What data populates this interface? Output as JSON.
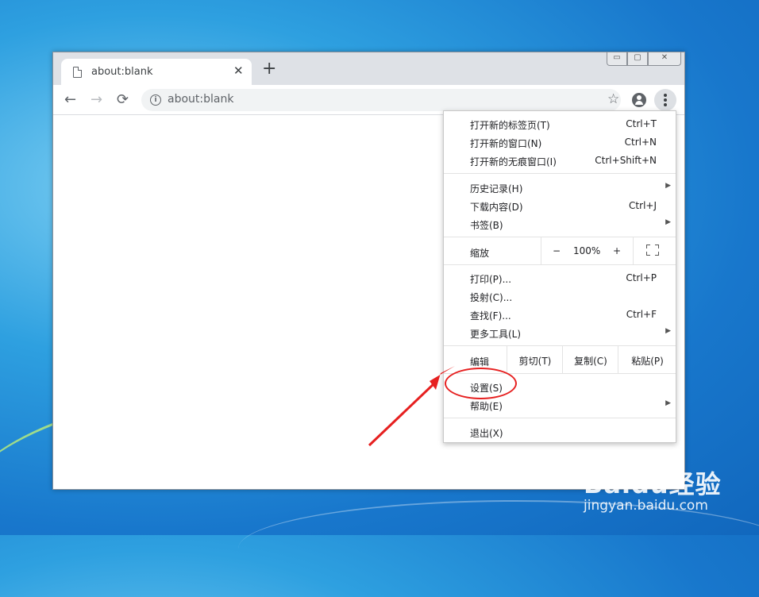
{
  "tab": {
    "title": "about:blank",
    "close_glyph": "✕",
    "new_tab_glyph": "+"
  },
  "window_controls": {
    "minimize": "▭",
    "maximize": "▢",
    "close": "✕"
  },
  "toolbar": {
    "back": "←",
    "forward": "→",
    "reload": "⟳",
    "url": "about:blank",
    "info_glyph": "i",
    "star": "☆"
  },
  "menu": {
    "new_tab": {
      "label": "打开新的标签页(T)",
      "shortcut": "Ctrl+T"
    },
    "new_window": {
      "label": "打开新的窗口(N)",
      "shortcut": "Ctrl+N"
    },
    "incognito": {
      "label": "打开新的无痕窗口(I)",
      "shortcut": "Ctrl+Shift+N"
    },
    "history": {
      "label": "历史记录(H)"
    },
    "downloads": {
      "label": "下载内容(D)",
      "shortcut": "Ctrl+J"
    },
    "bookmarks": {
      "label": "书签(B)"
    },
    "zoom": {
      "label": "缩放",
      "minus": "−",
      "value": "100%",
      "plus": "+"
    },
    "print": {
      "label": "打印(P)...",
      "shortcut": "Ctrl+P"
    },
    "cast": {
      "label": "投射(C)..."
    },
    "find": {
      "label": "查找(F)...",
      "shortcut": "Ctrl+F"
    },
    "more_tools": {
      "label": "更多工具(L)"
    },
    "edit": {
      "label": "编辑",
      "cut": "剪切(T)",
      "copy": "复制(C)",
      "paste": "粘贴(P)"
    },
    "settings": {
      "label": "设置(S)"
    },
    "help": {
      "label": "帮助(E)"
    },
    "exit": {
      "label": "退出(X)"
    },
    "submenu_arrow": "▶"
  },
  "watermark": {
    "brand": "Baidu经验",
    "url": "jingyan.baidu.com"
  },
  "colors": {
    "annotation_red": "#e62020",
    "desktop_blue": "#1877cc"
  }
}
